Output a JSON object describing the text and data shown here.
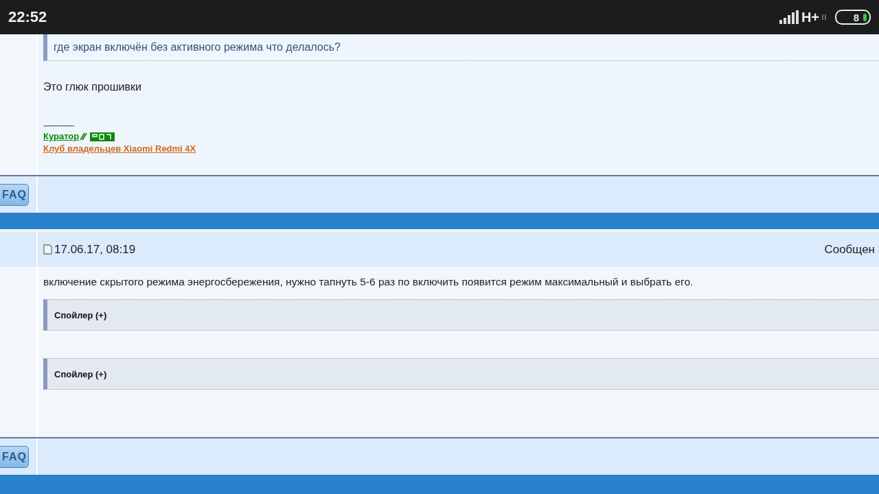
{
  "status_bar": {
    "time": "22:52",
    "network": "H+",
    "battery": "8"
  },
  "post_1": {
    "quote": "где экран включён без активного режима что делалось?",
    "text": "Это глюк прошивки",
    "signature_rule": "-------------------",
    "curator_label": "Куратор",
    "club_link": "Клуб владельцев Xiaomi Redmi 4X",
    "faq_button": "FAQ"
  },
  "post_2": {
    "date": "17.06.17, 08:19",
    "header_right": "Сообщен",
    "text": "включение скрытого режима энергосбережения, нужно тапнуть 5-6 раз по включить появится режим максимальный и выбрать его.",
    "spoilers": [
      {
        "label": "Спойлер (+)",
        "expanded": false
      },
      {
        "label": "Спойлер (+)",
        "expanded": false
      }
    ],
    "faq_button": "FAQ"
  }
}
